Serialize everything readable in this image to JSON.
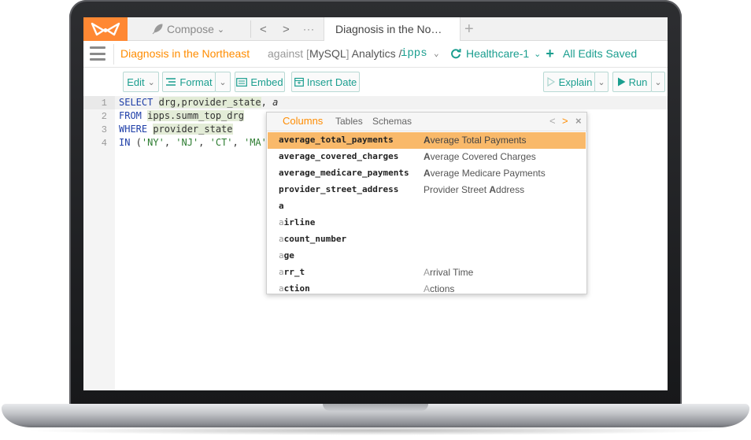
{
  "topbar": {
    "compose_label": "Compose",
    "active_tab": "Diagnosis in the No…",
    "nav_prev": "<",
    "nav_next": ">",
    "nav_more": "···",
    "new_tab": "+"
  },
  "titlebar": {
    "query_name": "Diagnosis in the Northeast",
    "against_label": "against",
    "db_name": "MySQL",
    "db_rest": "Analytics /",
    "schema": "ipps",
    "connection": "Healthcare-1",
    "save_status": "All Edits Saved"
  },
  "toolbar": {
    "edit": "Edit",
    "format": "Format",
    "embed": "Embed",
    "insert_date": "Insert Date",
    "explain": "Explain",
    "run": "Run"
  },
  "editor": {
    "lines": [
      {
        "num": "1",
        "tokens": [
          "SELECT",
          " ",
          "drg",
          ",",
          "provider_state",
          ", ",
          "a"
        ]
      },
      {
        "num": "2",
        "tokens": [
          "FROM",
          " ",
          "ipps.summ_top_drg"
        ]
      },
      {
        "num": "3",
        "tokens": [
          "WHERE",
          " ",
          "provider_state"
        ]
      },
      {
        "num": "4",
        "tokens": [
          "IN",
          " (",
          "'NY'",
          ", ",
          "'NJ'",
          ", ",
          "'CT'",
          ", ",
          "'MA'"
        ]
      }
    ]
  },
  "autocomplete": {
    "tabs": [
      "Columns",
      "Tables",
      "Schemas"
    ],
    "selected_tab": "Columns",
    "items": [
      {
        "prefix": "",
        "name": "average_total_payments",
        "desc_prefix": "A",
        "desc": "verage Total Payments",
        "selected": true
      },
      {
        "prefix": "",
        "name": "average_covered_charges",
        "desc_prefix": "A",
        "desc": "verage Covered Charges",
        "selected": false
      },
      {
        "prefix": "",
        "name": "average_medicare_payments",
        "desc_prefix": "A",
        "desc": "verage Medicare Payments",
        "selected": false
      },
      {
        "prefix": "",
        "name": "provider_street_address",
        "desc_prefix": "",
        "desc": "Provider Street ",
        "desc_bold_tail": "A",
        "desc_tail": "ddress",
        "selected": false
      },
      {
        "prefix": "a",
        "name": "",
        "desc_prefix": "",
        "desc": "",
        "selected": false
      },
      {
        "prefix": "a",
        "name": "irline",
        "desc_prefix": "",
        "desc": "",
        "selected": false
      },
      {
        "prefix": "a",
        "name": "count_number",
        "desc_prefix": "",
        "desc": "",
        "selected": false
      },
      {
        "prefix": "a",
        "name": "ge",
        "desc_prefix": "",
        "desc": "",
        "selected": false
      },
      {
        "prefix": "a",
        "name": "rr_t",
        "desc_prefix": "A",
        "desc": "rrival Time",
        "selected": false
      },
      {
        "prefix": "a",
        "name": "ction",
        "desc_prefix": "A",
        "desc": "ctions",
        "selected": false
      }
    ]
  },
  "colors": {
    "accent_orange": "#ff8c00",
    "logo_orange": "#ff8833",
    "teal": "#1a9e8f",
    "keyword_blue": "#1f3fa8",
    "string_green": "#2e7d32",
    "selected_row": "#f9b96a"
  },
  "icons": {
    "logo": "brand-logo-icon",
    "compose": "feather-icon",
    "menu": "hamburger-icon",
    "refresh": "refresh-icon",
    "format": "format-icon",
    "embed": "embed-icon",
    "calendar": "calendar-icon",
    "explain": "explain-icon",
    "run": "play-icon"
  }
}
